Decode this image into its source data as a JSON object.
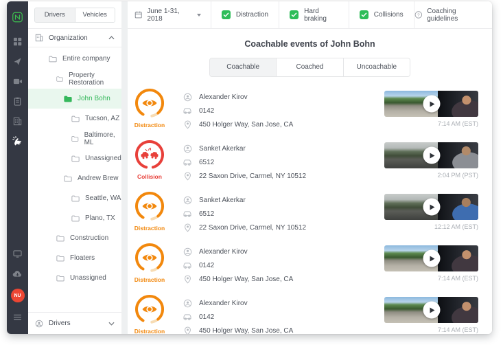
{
  "sidebar": {
    "avatar_initials": "NU",
    "icons": [
      "netradyne-logo",
      "dashboard",
      "navigation",
      "camera",
      "clipboard",
      "organization",
      "coaching",
      "monitor",
      "cloud-download",
      "menu"
    ]
  },
  "org_panel": {
    "toggle": {
      "drivers": "Drivers",
      "vehicles": "Vehicles"
    },
    "header": "Organization",
    "items": [
      {
        "label": "Entire company"
      },
      {
        "label": "Property Restoration"
      },
      {
        "label": "John Bohn",
        "selected": true
      },
      {
        "label": "Tucson, AZ"
      },
      {
        "label": "Baltimore, ML"
      },
      {
        "label": "Unassigned"
      },
      {
        "label": "Andrew Brew"
      },
      {
        "label": "Seattle, WA"
      },
      {
        "label": "Plano, TX"
      },
      {
        "label": "Construction"
      },
      {
        "label": "Floaters"
      },
      {
        "label": "Unassigned"
      }
    ],
    "footer": "Drivers"
  },
  "topbar": {
    "date_range": "June 1-31, 2018",
    "filters": [
      {
        "label": "Distraction",
        "checked": true
      },
      {
        "label": "Hard braking",
        "checked": true
      },
      {
        "label": "Collisions",
        "checked": true
      }
    ],
    "help": "Coaching guidelines"
  },
  "main": {
    "title": "Coachable events of John Bohn",
    "tabs": [
      {
        "label": "Coachable",
        "active": true
      },
      {
        "label": "Coached",
        "active": false
      },
      {
        "label": "Uncoachable",
        "active": false
      }
    ],
    "events": [
      {
        "type": "Distraction",
        "driver": "Alexander Kirov",
        "vehicle": "0142",
        "location": "450 Holger Way, San Jose, CA",
        "time": "7:14 AM (EST)"
      },
      {
        "type": "Collision",
        "driver": "Sanket Akerkar",
        "vehicle": "6512",
        "location": "22 Saxon Drive, Carmel, NY 10512",
        "time": "2:04 PM (PST)"
      },
      {
        "type": "Distraction",
        "driver": "Sanket Akerkar",
        "vehicle": "6512",
        "location": "22 Saxon Drive, Carmel, NY 10512",
        "time": "12:12 AM (EST)"
      },
      {
        "type": "Distraction",
        "driver": "Alexander Kirov",
        "vehicle": "0142",
        "location": "450 Holger Way, San Jose, CA",
        "time": "7:14 AM (EST)"
      },
      {
        "type": "Distraction",
        "driver": "Alexander Kirov",
        "vehicle": "0142",
        "location": "450 Holger Way, San Jose, CA",
        "time": "7:14 AM (EST)"
      }
    ]
  },
  "colors": {
    "accent_green": "#2EBD59",
    "distraction_orange": "#F2880D",
    "collision_red": "#E8403A",
    "sidebar_dark": "#343843",
    "selected_row_bg": "#e9f7ee"
  }
}
